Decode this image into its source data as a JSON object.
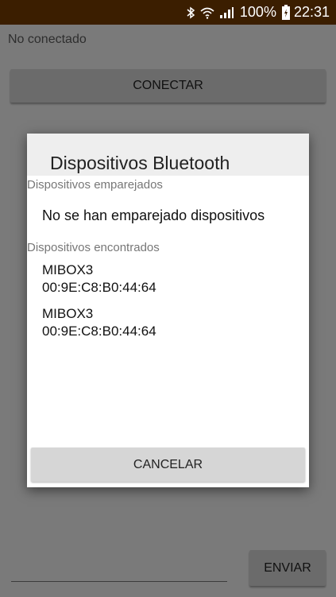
{
  "status_bar": {
    "battery": "100%",
    "time": "22:31",
    "icons": [
      "bluetooth-icon",
      "wifi-icon",
      "signal-icon",
      "battery-icon"
    ]
  },
  "app": {
    "connection_status": "No conectado",
    "connect_label": "CONECTAR",
    "send_label": "ENVIAR",
    "send_input_value": ""
  },
  "dialog": {
    "title": "Dispositivos Bluetooth",
    "paired_header": "Dispositivos emparejados",
    "no_paired_text": "No se han emparejado dispositivos",
    "found_header": "Dispositivos encontrados",
    "devices": [
      {
        "name": "MIBOX3",
        "address": "00:9E:C8:B0:44:64"
      },
      {
        "name": "MIBOX3",
        "address": "00:9E:C8:B0:44:64"
      }
    ],
    "cancel_label": "CANCELAR"
  }
}
